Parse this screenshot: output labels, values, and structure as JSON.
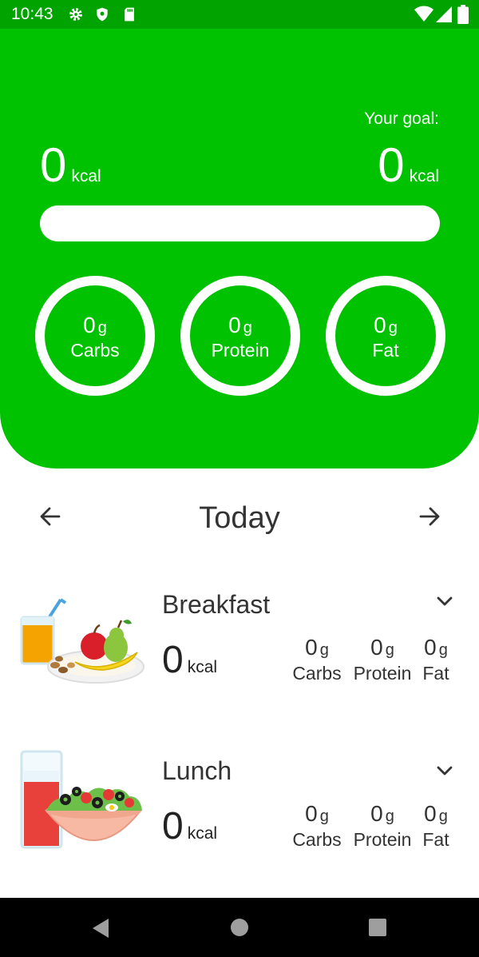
{
  "status_bar": {
    "time": "10:43"
  },
  "header": {
    "goal_label": "Your goal:",
    "consumed": {
      "value": "0",
      "unit": "kcal"
    },
    "goal": {
      "value": "0",
      "unit": "kcal"
    },
    "progress": 0,
    "macros": [
      {
        "value": "0",
        "unit": "g",
        "label": "Carbs"
      },
      {
        "value": "0",
        "unit": "g",
        "label": "Protein"
      },
      {
        "value": "0",
        "unit": "g",
        "label": "Fat"
      }
    ]
  },
  "day_nav": {
    "title": "Today"
  },
  "meals": [
    {
      "name": "Breakfast",
      "kcal": "0",
      "kcal_unit": "kcal",
      "macros": [
        {
          "value": "0",
          "unit": "g",
          "label": "Carbs"
        },
        {
          "value": "0",
          "unit": "g",
          "label": "Protein"
        },
        {
          "value": "0",
          "unit": "g",
          "label": "Fat"
        }
      ]
    },
    {
      "name": "Lunch",
      "kcal": "0",
      "kcal_unit": "kcal",
      "macros": [
        {
          "value": "0",
          "unit": "g",
          "label": "Carbs"
        },
        {
          "value": "0",
          "unit": "g",
          "label": "Protein"
        },
        {
          "value": "0",
          "unit": "g",
          "label": "Fat"
        }
      ]
    }
  ],
  "colors": {
    "primary": "#00c200",
    "status_bar": "#00a300",
    "text_dark": "#333333"
  },
  "icons": [
    "gear-icon",
    "shield-icon",
    "sd-card-icon",
    "wifi-icon",
    "signal-icon",
    "battery-icon",
    "arrow-left-icon",
    "arrow-right-icon",
    "chevron-down-icon",
    "back-icon",
    "home-icon",
    "recents-icon"
  ]
}
